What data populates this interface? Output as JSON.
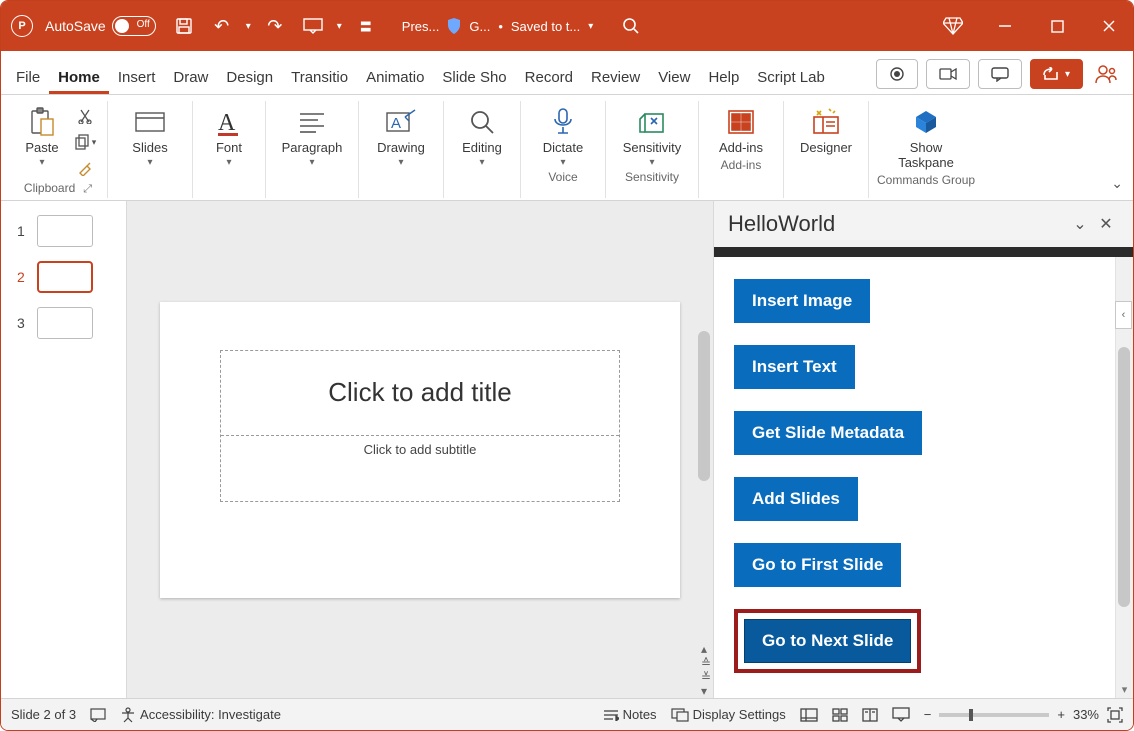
{
  "title": {
    "autosave_label": "AutoSave",
    "autosave_state": "Off",
    "file_truncated": "Pres...",
    "sensitivity_trunc": "G...",
    "saved_status": "Saved to t...",
    "pp_letter": "P"
  },
  "tabs": {
    "file": "File",
    "home": "Home",
    "insert": "Insert",
    "draw": "Draw",
    "design": "Design",
    "transitions": "Transitio",
    "animations": "Animatio",
    "slideshow": "Slide Sho",
    "record": "Record",
    "review": "Review",
    "view": "View",
    "help": "Help",
    "scriptlab": "Script Lab"
  },
  "ribbon": {
    "paste": "Paste",
    "clipboard": "Clipboard",
    "slides": "Slides",
    "font": "Font",
    "paragraph": "Paragraph",
    "drawing": "Drawing",
    "editing": "Editing",
    "dictate": "Dictate",
    "voice": "Voice",
    "sensitivity": "Sensitivity",
    "sensitivity_group": "Sensitivity",
    "addins": "Add-ins",
    "addins_group": "Add-ins",
    "designer": "Designer",
    "show_taskpane": "Show Taskpane",
    "commands_group": "Commands Group"
  },
  "thumbs": {
    "n1": "1",
    "n2": "2",
    "n3": "3"
  },
  "slide": {
    "title_placeholder": "Click to add title",
    "subtitle_placeholder": "Click to add subtitle"
  },
  "taskpane": {
    "title": "HelloWorld",
    "insert_image": "Insert Image",
    "insert_text": "Insert Text",
    "get_metadata": "Get Slide Metadata",
    "add_slides": "Add Slides",
    "go_first": "Go to First Slide",
    "go_next": "Go to Next Slide"
  },
  "status": {
    "slide_info": "Slide 2 of 3",
    "accessibility": "Accessibility: Investigate",
    "notes": "Notes",
    "display": "Display Settings",
    "zoom_pct": "33%"
  },
  "glyph": {
    "save": "🖫",
    "undo": "↶",
    "redo": "↷",
    "present": "▢",
    "more": "⋯",
    "caretdown": "▾",
    "search": "⌕",
    "diamond": "◈",
    "min": "—",
    "max": "▢",
    "close": "✕",
    "record": "◉",
    "teams": "👥",
    "comment": "💬",
    "share": "➦",
    "user": "👤",
    "cut": "✂",
    "copy": "⧉",
    "brush": "🖌",
    "scissors": "✂",
    "chevup": "⌃",
    "chevdown": "⌄",
    "dblup": "≙",
    "dbldn": "≚",
    "left": "‹"
  }
}
